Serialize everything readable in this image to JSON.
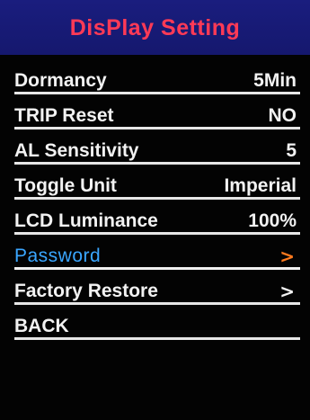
{
  "header": {
    "title": "DisPlay Setting",
    "bg_color": "#15186e",
    "title_color": "#ff3a56"
  },
  "menu": {
    "items": [
      {
        "label": "Dormancy",
        "value": "5Min"
      },
      {
        "label": "TRIP Reset",
        "value": "NO"
      },
      {
        "label": "AL Sensitivity",
        "value": "5"
      },
      {
        "label": "Toggle Unit",
        "value": "Imperial"
      },
      {
        "label": "LCD Luminance",
        "value": "100%"
      },
      {
        "label": "Password",
        "value": ">",
        "selected": true,
        "icon": "chevron-right-icon"
      },
      {
        "label": "Factory Restore",
        "value": ">",
        "icon": "chevron-right-icon"
      },
      {
        "label": "BACK",
        "value": ""
      }
    ],
    "selected_color": "#3aa6ff",
    "selected_chevron_color": "#ff7a1e",
    "text_color": "#f2f2f2"
  }
}
